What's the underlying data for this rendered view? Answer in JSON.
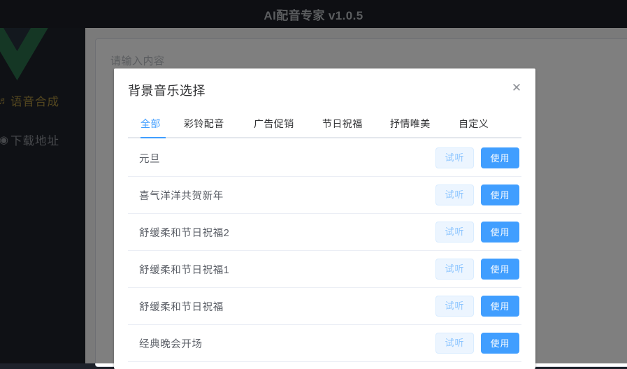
{
  "window": {
    "title": "AI配音专家 v1.0.5"
  },
  "sidebar": {
    "logo_icon": "vue-logo",
    "items": [
      {
        "label": "语音合成",
        "icon": "microphone-icon",
        "active": true
      },
      {
        "label": "下载地址",
        "icon": "download-icon",
        "active": false
      }
    ]
  },
  "main": {
    "editor": {
      "placeholder": "请输入内容",
      "value": ""
    }
  },
  "dialog": {
    "title": "背景音乐选择",
    "close_icon": "close-icon",
    "tabs": [
      {
        "label": "全部",
        "active": true
      },
      {
        "label": "彩铃配音",
        "active": false
      },
      {
        "label": "广告促销",
        "active": false
      },
      {
        "label": "节日祝福",
        "active": false
      },
      {
        "label": "抒情唯美",
        "active": false
      },
      {
        "label": "自定义",
        "active": false
      }
    ],
    "buttons": {
      "preview_label": "试听",
      "use_label": "使用"
    },
    "list": [
      {
        "name": "元旦"
      },
      {
        "name": "喜气洋洋共贺新年"
      },
      {
        "name": "舒缓柔和节日祝福2"
      },
      {
        "name": "舒缓柔和节日祝福1"
      },
      {
        "name": "舒缓柔和节日祝福"
      },
      {
        "name": "经典晚会开场"
      }
    ]
  },
  "colors": {
    "accent": "#409eff",
    "titlebar_bg": "#1c1f27",
    "sidebar_bg": "#1e222b",
    "sidebar_active": "#a98e3e",
    "sidebar_inactive": "#8d9096",
    "vue_green": "#2a6f4b",
    "vue_dark": "#27313c"
  }
}
